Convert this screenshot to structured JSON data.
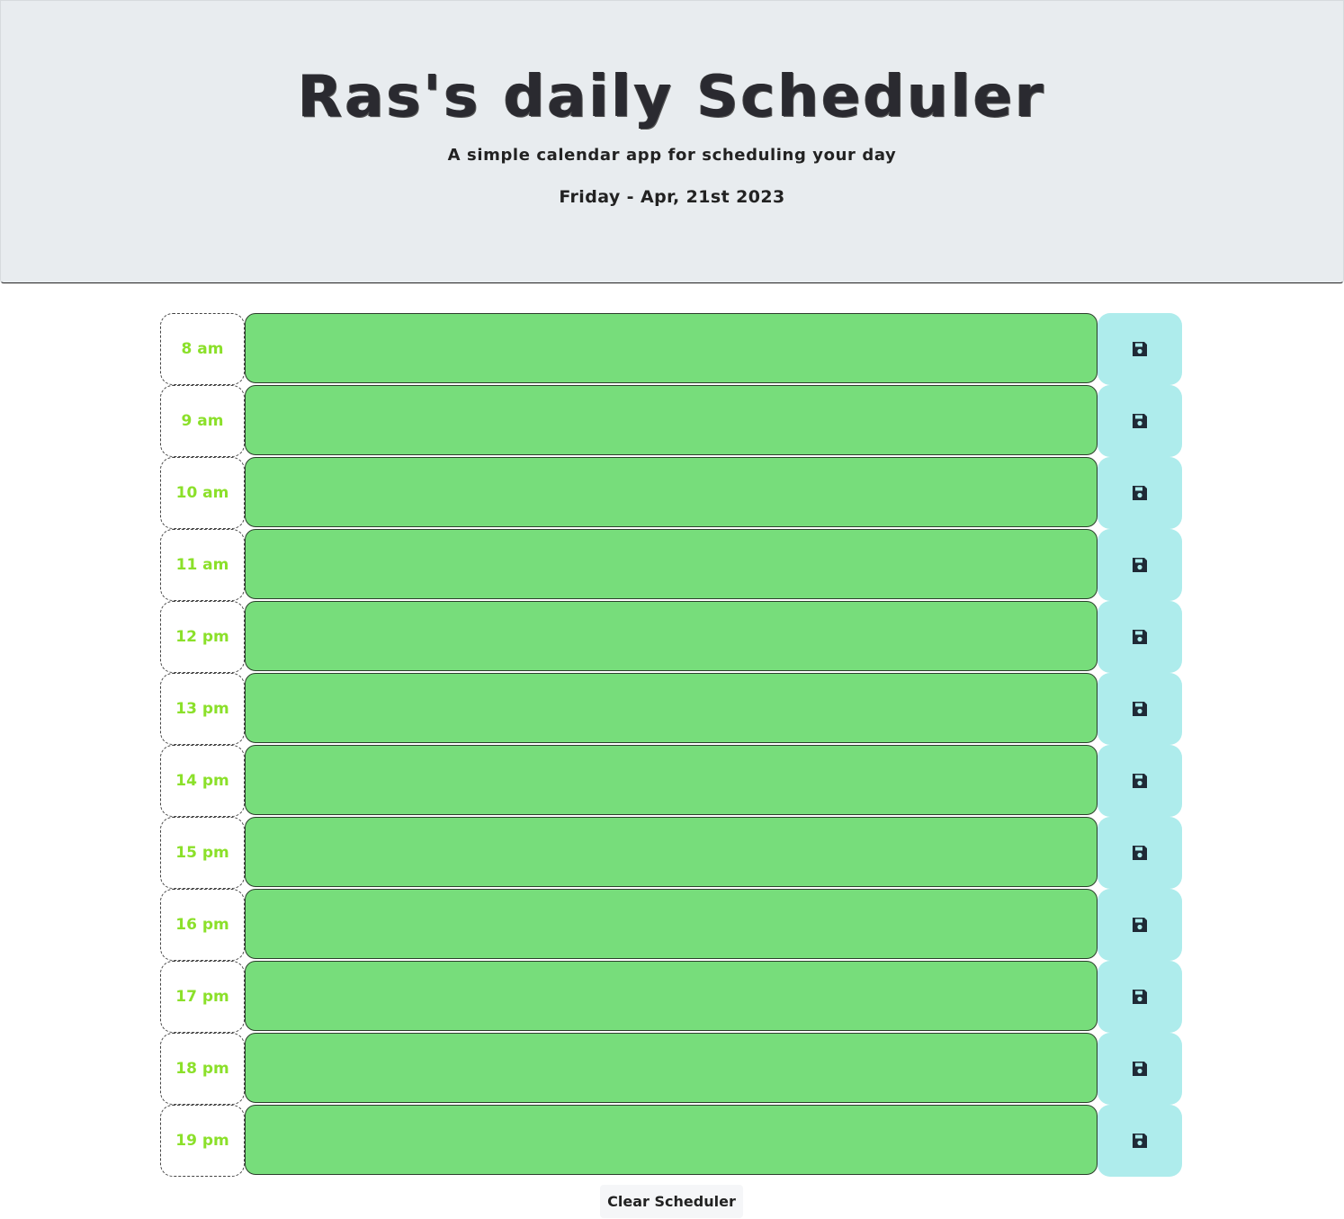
{
  "header": {
    "title": "Ras's daily Scheduler",
    "subtitle": "A simple calendar app for scheduling your day",
    "date": "Friday - Apr, 21st 2023"
  },
  "hours": [
    {
      "label": "8 am",
      "text": ""
    },
    {
      "label": "9 am",
      "text": ""
    },
    {
      "label": "10 am",
      "text": ""
    },
    {
      "label": "11 am",
      "text": ""
    },
    {
      "label": "12 pm",
      "text": ""
    },
    {
      "label": "13 pm",
      "text": ""
    },
    {
      "label": "14 pm",
      "text": ""
    },
    {
      "label": "15 pm",
      "text": ""
    },
    {
      "label": "16 pm",
      "text": ""
    },
    {
      "label": "17 pm",
      "text": ""
    },
    {
      "label": "18 pm",
      "text": ""
    },
    {
      "label": "19 pm",
      "text": ""
    }
  ],
  "save_icon": "floppy-disk-icon",
  "clear_label": "Clear Scheduler",
  "colors": {
    "header_bg": "#e8ecef",
    "future": "#77dd7b",
    "save_bg": "#aeecec",
    "hour_text": "#8be02a"
  }
}
